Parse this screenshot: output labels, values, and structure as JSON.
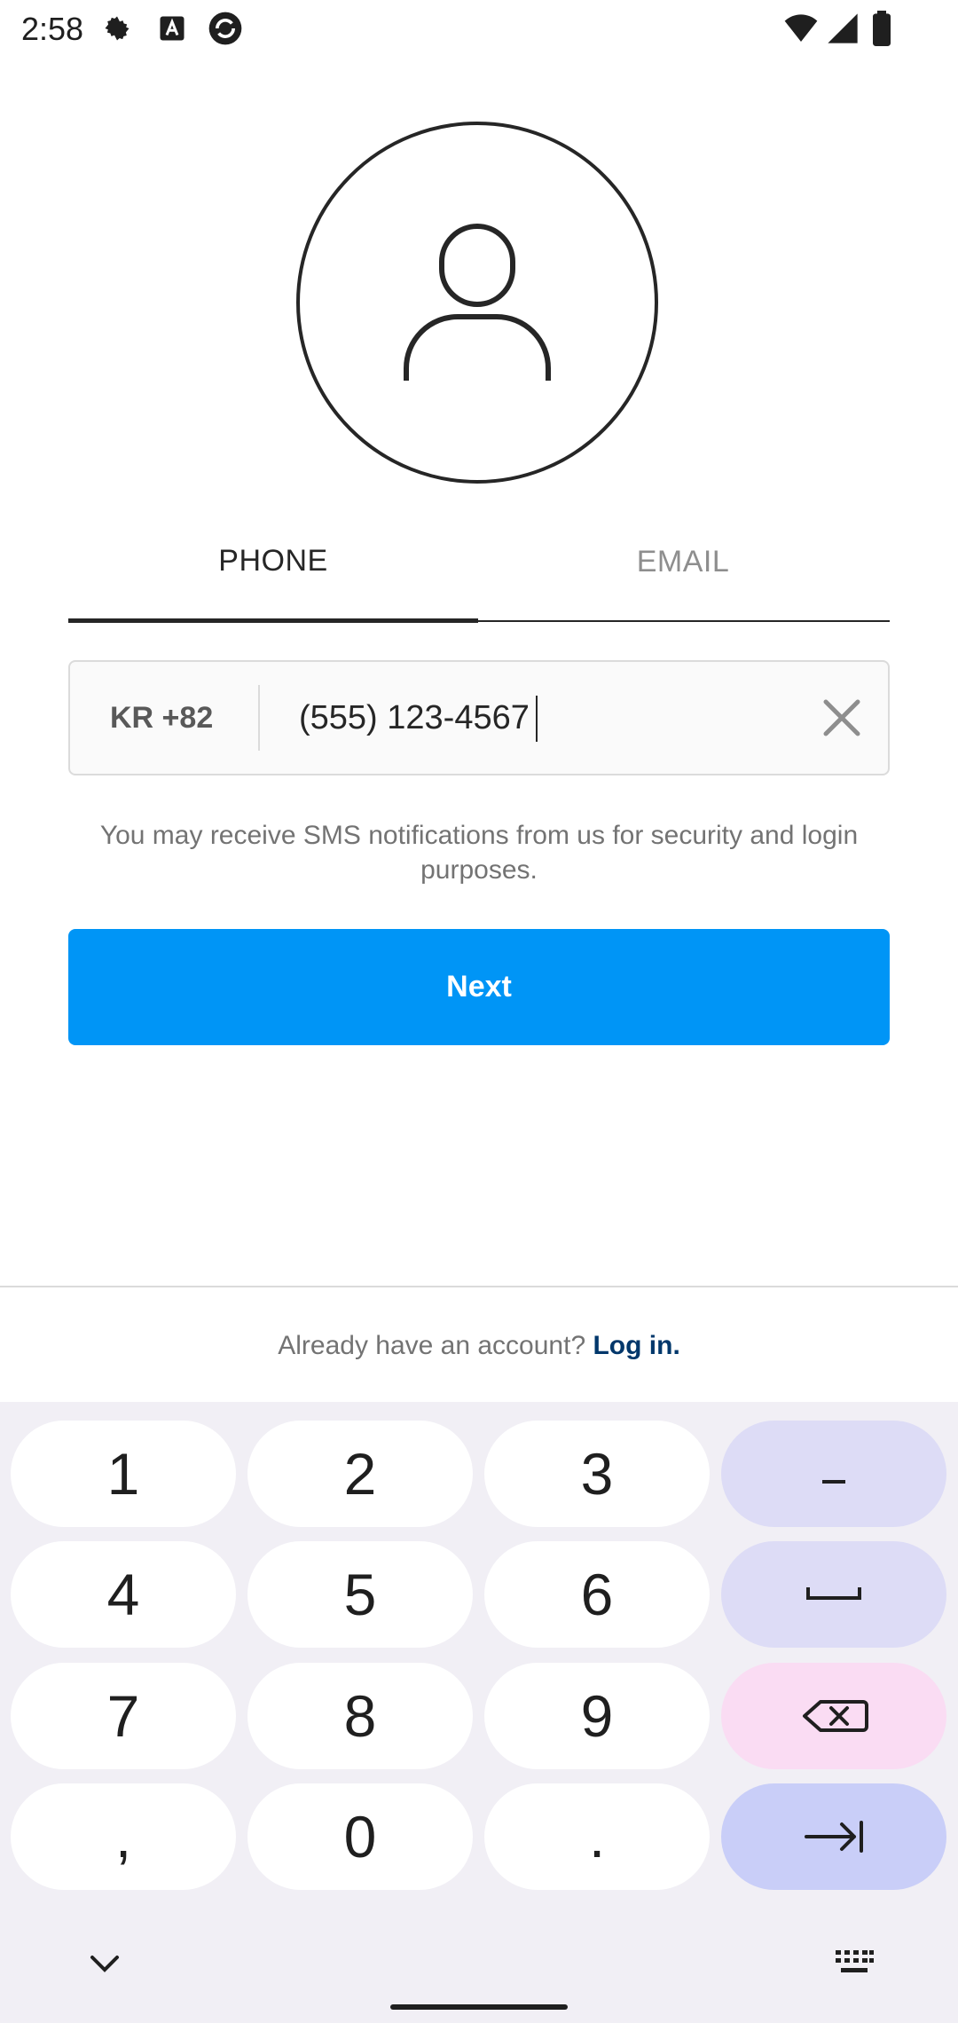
{
  "status_bar": {
    "time": "2:58"
  },
  "tabs": [
    {
      "label": "PHONE",
      "active": true
    },
    {
      "label": "EMAIL",
      "active": false
    }
  ],
  "phone_input": {
    "country_code": "KR +82",
    "value": "(555) 123-4567"
  },
  "sms_note": "You may receive SMS notifications from us for security and login purposes.",
  "next_button": {
    "label": "Next"
  },
  "footer": {
    "prompt": "Already have an account?",
    "link": "Log in."
  },
  "keyboard": {
    "row1": [
      "1",
      "2",
      "3"
    ],
    "row2": [
      "4",
      "5",
      "6"
    ],
    "row3": [
      "7",
      "8",
      "9"
    ],
    "row4": [
      ",",
      "0",
      "."
    ],
    "fn_icons": [
      "minus-icon",
      "space-icon",
      "backspace-icon",
      "next-field-icon"
    ]
  },
  "colors": {
    "primary_button": "#0095f6",
    "link": "#00376b",
    "keyboard_bg": "#f1eff5"
  }
}
